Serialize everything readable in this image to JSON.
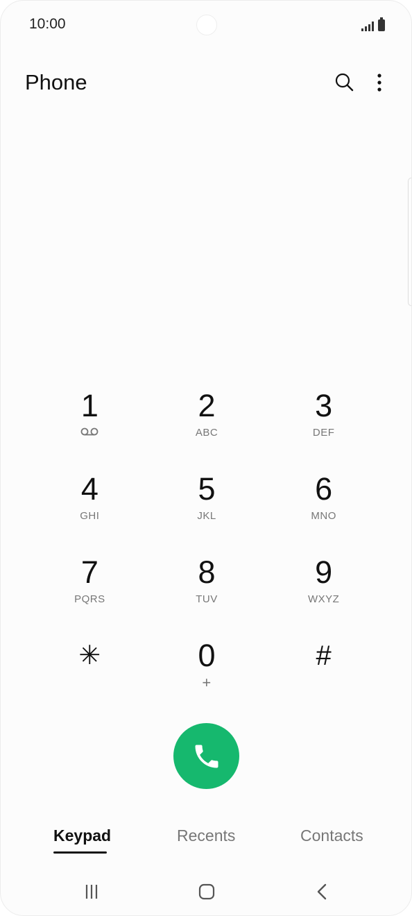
{
  "status_bar": {
    "time": "10:00",
    "icons": [
      "camera-cutout",
      "signal-icon",
      "battery-icon"
    ]
  },
  "header": {
    "title": "Phone",
    "icons": [
      "search-icon",
      "more-vert-icon"
    ]
  },
  "keypad": {
    "keys": [
      {
        "digit": "1",
        "letters": "",
        "icon": "voicemail-icon"
      },
      {
        "digit": "2",
        "letters": "ABC"
      },
      {
        "digit": "3",
        "letters": "DEF"
      },
      {
        "digit": "4",
        "letters": "GHI"
      },
      {
        "digit": "5",
        "letters": "JKL"
      },
      {
        "digit": "6",
        "letters": "MNO"
      },
      {
        "digit": "7",
        "letters": "PQRS"
      },
      {
        "digit": "8",
        "letters": "TUV"
      },
      {
        "digit": "9",
        "letters": "WXYZ"
      },
      {
        "digit": "✳",
        "letters": ""
      },
      {
        "digit": "0",
        "letters": "+"
      },
      {
        "digit": "#",
        "letters": ""
      }
    ]
  },
  "call_button": {
    "icon": "phone-icon",
    "color": "#16b86e"
  },
  "tabs": [
    {
      "label": "Keypad",
      "active": true
    },
    {
      "label": "Recents",
      "active": false
    },
    {
      "label": "Contacts",
      "active": false
    }
  ],
  "nav_bar": {
    "icons": [
      "recent-apps-icon",
      "home-icon",
      "back-icon"
    ]
  }
}
